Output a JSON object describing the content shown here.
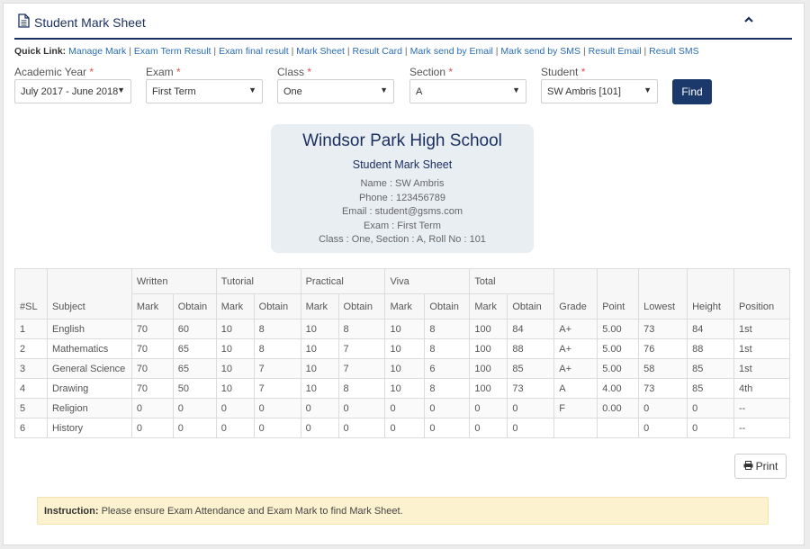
{
  "header": {
    "title": "Student Mark Sheet"
  },
  "quick_links": {
    "title": "Quick Link:",
    "items": [
      "Manage Mark",
      "Exam Term Result",
      "Exam final result",
      "Mark Sheet",
      "Result Card",
      "Mark send by Email",
      "Mark send by SMS",
      "Result Email",
      "Result SMS"
    ]
  },
  "filters": {
    "academic_year": {
      "label": "Academic Year",
      "value": "July 2017 - June 2018"
    },
    "exam": {
      "label": "Exam",
      "value": "First Term"
    },
    "class": {
      "label": "Class",
      "value": "One"
    },
    "section": {
      "label": "Section",
      "value": "A"
    },
    "student": {
      "label": "Student",
      "value": "SW Ambris [101]"
    },
    "required_mark": "*",
    "find_label": "Find"
  },
  "card": {
    "school_name": "Windsor Park High School",
    "title": "Student Mark Sheet",
    "name": "Name : SW Ambris",
    "phone": "Phone : 123456789",
    "email": "Email : student@gsms.com",
    "exam": "Exam : First Term",
    "class_info": "Class : One, Section : A, Roll No : 101"
  },
  "table": {
    "headers": {
      "sl": "#SL",
      "subject": "Subject",
      "written": "Written",
      "tutorial": "Tutorial",
      "practical": "Practical",
      "viva": "Viva",
      "total": "Total",
      "mark": "Mark",
      "obtain": "Obtain",
      "grade": "Grade",
      "point": "Point",
      "lowest": "Lowest",
      "height": "Height",
      "position": "Position"
    },
    "rows": [
      [
        "1",
        "English",
        "70",
        "60",
        "10",
        "8",
        "10",
        "8",
        "10",
        "8",
        "100",
        "84",
        "A+",
        "5.00",
        "73",
        "84",
        "1st"
      ],
      [
        "2",
        "Mathematics",
        "70",
        "65",
        "10",
        "8",
        "10",
        "7",
        "10",
        "8",
        "100",
        "88",
        "A+",
        "5.00",
        "76",
        "88",
        "1st"
      ],
      [
        "3",
        "General Science",
        "70",
        "65",
        "10",
        "7",
        "10",
        "7",
        "10",
        "6",
        "100",
        "85",
        "A+",
        "5.00",
        "58",
        "85",
        "1st"
      ],
      [
        "4",
        "Drawing",
        "70",
        "50",
        "10",
        "7",
        "10",
        "8",
        "10",
        "8",
        "100",
        "73",
        "A",
        "4.00",
        "73",
        "85",
        "4th"
      ],
      [
        "5",
        "Religion",
        "0",
        "0",
        "0",
        "0",
        "0",
        "0",
        "0",
        "0",
        "0",
        "0",
        "F",
        "0.00",
        "0",
        "0",
        "--"
      ],
      [
        "6",
        "History",
        "0",
        "0",
        "0",
        "0",
        "0",
        "0",
        "0",
        "0",
        "0",
        "0",
        "",
        "",
        "0",
        "0",
        "--"
      ]
    ]
  },
  "print_label": "Print",
  "instruction": {
    "label": "Instruction:",
    "text": "Please ensure Exam Attendance and Exam Mark to find Mark Sheet."
  }
}
